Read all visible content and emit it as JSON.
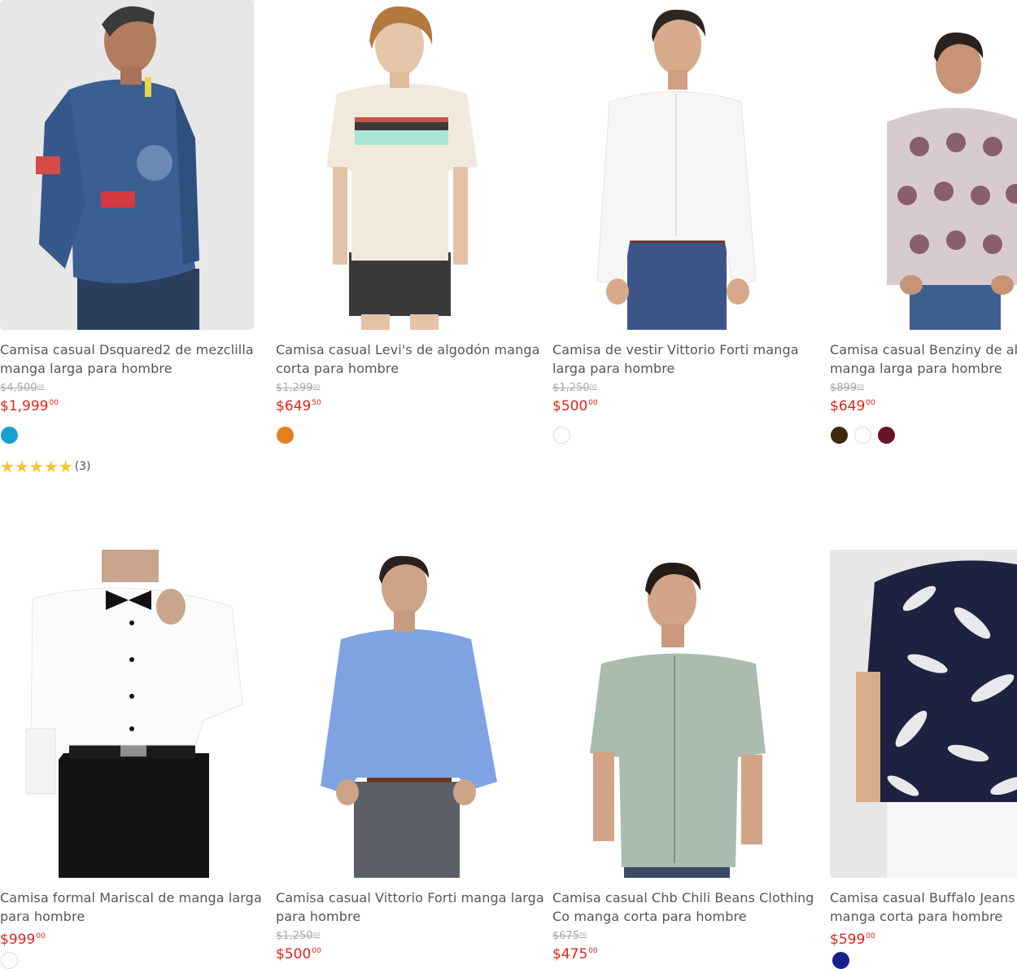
{
  "products": [
    {
      "title_line1": "Camisa casual Dsquared2 de mezclilla",
      "title_line2": "manga larga para hombre",
      "old_price": "$4,500",
      "old_cents": "00",
      "price": "$1,999",
      "price_cents": "00",
      "swatches": [
        "#1b9fd1"
      ],
      "rating_stars": 5,
      "rating_count": "(3)"
    },
    {
      "title_line1": "Camisa casual Levi's de algodón manga",
      "title_line2": "corta para hombre",
      "old_price": "$1,299",
      "old_cents": "00",
      "price": "$649",
      "price_cents": "50",
      "swatches": [
        "#e57e1e"
      ]
    },
    {
      "title_line1": "Camisa de vestir Vittorio Forti manga",
      "title_line2": "larga para hombre",
      "old_price": "$1,250",
      "old_cents": "00",
      "price": "$500",
      "price_cents": "00",
      "swatches": [
        "#ffffff"
      ]
    },
    {
      "title_line1": "Camisa casual Benziny de algo",
      "title_line2": "manga larga para hombre",
      "old_price": "$899",
      "old_cents": "00",
      "price": "$649",
      "price_cents": "00",
      "swatches": [
        "#3f2a10",
        "#ffffff",
        "#6a1427"
      ]
    },
    {
      "title_line1": "Camisa formal Mariscal de manga larga",
      "title_line2": "para hombre",
      "price": "$999",
      "price_cents": "00",
      "swatches": [
        "#ffffff"
      ]
    },
    {
      "title_line1": "Camisa casual Vittorio Forti manga larga",
      "title_line2": "para hombre",
      "old_price": "$1,250",
      "old_cents": "00",
      "price": "$500",
      "price_cents": "00"
    },
    {
      "title_line1": "Camisa casual Chb Chili Beans Clothing",
      "title_line2": "Co manga corta para hombre",
      "old_price": "$675",
      "old_cents": "00",
      "price": "$475",
      "price_cents": "00"
    },
    {
      "title_line1": "Camisa casual Buffalo Jeans D",
      "title_line2": "manga corta para hombre",
      "price": "$599",
      "price_cents": "00",
      "swatches": [
        "#1a1f8f"
      ]
    }
  ],
  "colors": {
    "price_red": "#e0241a",
    "star_yellow": "#f4c62a",
    "text_gray": "#555555"
  }
}
